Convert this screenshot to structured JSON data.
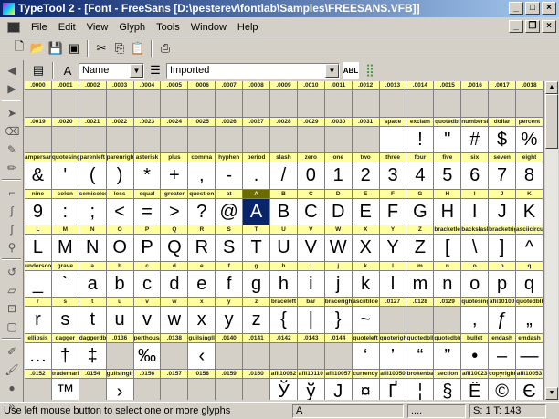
{
  "window": {
    "title": "TypeTool 2 - [Font - FreeSans [D:\\pesterev\\fontlab\\Samples\\FREESANS.VFB]]"
  },
  "menu": [
    "File",
    "Edit",
    "View",
    "Glyph",
    "Tools",
    "Window",
    "Help"
  ],
  "font_toolbar": {
    "caption_mode": "Name",
    "encoding": "Imported"
  },
  "grid": {
    "selected": "A",
    "rows": [
      [
        [
          ".0000",
          null
        ],
        [
          ".0001",
          null
        ],
        [
          ".0002",
          null
        ],
        [
          ".0003",
          null
        ],
        [
          ".0004",
          null
        ],
        [
          ".0005",
          null
        ],
        [
          ".0006",
          null
        ],
        [
          ".0007",
          null
        ],
        [
          ".0008",
          null
        ],
        [
          ".0009",
          null
        ],
        [
          ".0010",
          null
        ],
        [
          ".0011",
          null
        ],
        [
          ".0012",
          null
        ],
        [
          ".0013",
          null
        ],
        [
          ".0014",
          null
        ],
        [
          ".0015",
          null
        ],
        [
          ".0016",
          null
        ],
        [
          ".0017",
          null
        ],
        [
          ".0018",
          null
        ]
      ],
      [
        [
          ".0019",
          null
        ],
        [
          ".0020",
          null
        ],
        [
          ".0021",
          null
        ],
        [
          ".0022",
          null
        ],
        [
          ".0023",
          null
        ],
        [
          ".0024",
          null
        ],
        [
          ".0025",
          null
        ],
        [
          ".0026",
          null
        ],
        [
          ".0027",
          null
        ],
        [
          ".0028",
          null
        ],
        [
          ".0029",
          null
        ],
        [
          ".0030",
          null
        ],
        [
          ".0031",
          null
        ],
        [
          "space",
          ""
        ],
        [
          "exclam",
          "!"
        ],
        [
          "quotedbl",
          "\""
        ],
        [
          "numbersign",
          "#"
        ],
        [
          "dollar",
          "$"
        ],
        [
          "percent",
          "%"
        ]
      ],
      [
        [
          "ampersand",
          "&"
        ],
        [
          "quotesingle",
          "'"
        ],
        [
          "parenleft",
          "("
        ],
        [
          "parenright",
          ")"
        ],
        [
          "asterisk",
          "*"
        ],
        [
          "plus",
          "+"
        ],
        [
          "comma",
          ","
        ],
        [
          "hyphen",
          "-"
        ],
        [
          "period",
          "."
        ],
        [
          "slash",
          "/"
        ],
        [
          "zero",
          "0"
        ],
        [
          "one",
          "1"
        ],
        [
          "two",
          "2"
        ],
        [
          "three",
          "3"
        ],
        [
          "four",
          "4"
        ],
        [
          "five",
          "5"
        ],
        [
          "six",
          "6"
        ],
        [
          "seven",
          "7"
        ],
        [
          "eight",
          "8"
        ]
      ],
      [
        [
          "nine",
          "9"
        ],
        [
          "colon",
          ":"
        ],
        [
          "semicolon",
          ";"
        ],
        [
          "less",
          "<"
        ],
        [
          "equal",
          "="
        ],
        [
          "greater",
          ">"
        ],
        [
          "question",
          "?"
        ],
        [
          "at",
          "@"
        ],
        [
          "A",
          "A"
        ],
        [
          "B",
          "B"
        ],
        [
          "C",
          "C"
        ],
        [
          "D",
          "D"
        ],
        [
          "E",
          "E"
        ],
        [
          "F",
          "F"
        ],
        [
          "G",
          "G"
        ],
        [
          "H",
          "H"
        ],
        [
          "I",
          "I"
        ],
        [
          "J",
          "J"
        ],
        [
          "K",
          "K"
        ]
      ],
      [
        [
          "L",
          "L"
        ],
        [
          "M",
          "M"
        ],
        [
          "N",
          "N"
        ],
        [
          "O",
          "O"
        ],
        [
          "P",
          "P"
        ],
        [
          "Q",
          "Q"
        ],
        [
          "R",
          "R"
        ],
        [
          "S",
          "S"
        ],
        [
          "T",
          "T"
        ],
        [
          "U",
          "U"
        ],
        [
          "V",
          "V"
        ],
        [
          "W",
          "W"
        ],
        [
          "X",
          "X"
        ],
        [
          "Y",
          "Y"
        ],
        [
          "Z",
          "Z"
        ],
        [
          "bracketleft",
          "["
        ],
        [
          "backslash",
          "\\"
        ],
        [
          "bracketright",
          "]"
        ],
        [
          "asciicircum",
          "^"
        ]
      ],
      [
        [
          "underscore",
          "_"
        ],
        [
          "grave",
          "`"
        ],
        [
          "a",
          "a"
        ],
        [
          "b",
          "b"
        ],
        [
          "c",
          "c"
        ],
        [
          "d",
          "d"
        ],
        [
          "e",
          "e"
        ],
        [
          "f",
          "f"
        ],
        [
          "g",
          "g"
        ],
        [
          "h",
          "h"
        ],
        [
          "i",
          "i"
        ],
        [
          "j",
          "j"
        ],
        [
          "k",
          "k"
        ],
        [
          "l",
          "l"
        ],
        [
          "m",
          "m"
        ],
        [
          "n",
          "n"
        ],
        [
          "o",
          "o"
        ],
        [
          "p",
          "p"
        ],
        [
          "q",
          "q"
        ]
      ],
      [
        [
          "r",
          "r"
        ],
        [
          "s",
          "s"
        ],
        [
          "t",
          "t"
        ],
        [
          "u",
          "u"
        ],
        [
          "v",
          "v"
        ],
        [
          "w",
          "w"
        ],
        [
          "x",
          "x"
        ],
        [
          "y",
          "y"
        ],
        [
          "z",
          "z"
        ],
        [
          "braceleft",
          "{"
        ],
        [
          "bar",
          "|"
        ],
        [
          "braceright",
          "}"
        ],
        [
          "asciitilde",
          "~"
        ],
        [
          ".0127",
          null
        ],
        [
          ".0128",
          null
        ],
        [
          ".0129",
          null
        ],
        [
          "quotesinglbase",
          "‚"
        ],
        [
          "afii10100",
          "ƒ"
        ],
        [
          "quotedblbase",
          "„"
        ]
      ],
      [
        [
          "ellipsis",
          "…"
        ],
        [
          "dagger",
          "†"
        ],
        [
          "daggerdbl",
          "‡"
        ],
        [
          ".0136",
          null
        ],
        [
          "perthousand",
          "‰"
        ],
        [
          ".0138",
          null
        ],
        [
          "guilsinglleft",
          "‹"
        ],
        [
          ".0140",
          null
        ],
        [
          ".0141",
          null
        ],
        [
          ".0142",
          null
        ],
        [
          ".0143",
          null
        ],
        [
          ".0144",
          null
        ],
        [
          "quoteleft",
          "‘"
        ],
        [
          "quoteright",
          "’"
        ],
        [
          "quotedblleft",
          "“"
        ],
        [
          "quotedblright",
          "”"
        ],
        [
          "bullet",
          "•"
        ],
        [
          "endash",
          "–"
        ],
        [
          "emdash",
          "—"
        ]
      ],
      [
        [
          ".0152",
          null
        ],
        [
          "trademark",
          "™"
        ],
        [
          ".0154",
          null
        ],
        [
          "guilsinglright",
          "›"
        ],
        [
          ".0156",
          null
        ],
        [
          ".0157",
          null
        ],
        [
          ".0158",
          null
        ],
        [
          ".0159",
          null
        ],
        [
          ".0160",
          null
        ],
        [
          "afii10062",
          "Ў"
        ],
        [
          "afii10110",
          "ў"
        ],
        [
          "afii10057",
          "Ј"
        ],
        [
          "currency",
          "¤"
        ],
        [
          "afii10050",
          "Ґ"
        ],
        [
          "brokenbar",
          "¦"
        ],
        [
          "section",
          "§"
        ],
        [
          "afii10023",
          "Ё"
        ],
        [
          "copyright",
          "©"
        ],
        [
          "afii10053",
          "Є"
        ]
      ]
    ]
  },
  "status": {
    "message": "Use left mouse button to select one or more glyphs",
    "glyph": "A",
    "unicode": "....",
    "counts": "S: 1 T: 143"
  }
}
